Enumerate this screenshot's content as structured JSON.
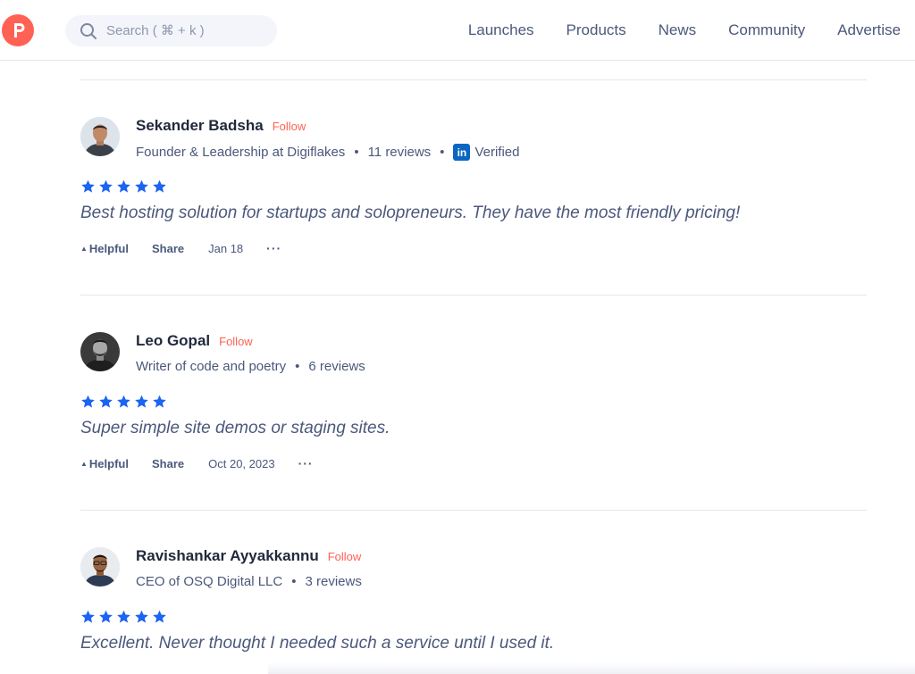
{
  "brand": {
    "logo_letter": "P",
    "accent": "#ff6154"
  },
  "search": {
    "placeholder": "Search ( ⌘ + k )",
    "value": ""
  },
  "nav": {
    "items": [
      {
        "label": "Launches"
      },
      {
        "label": "Products"
      },
      {
        "label": "News"
      },
      {
        "label": "Community"
      },
      {
        "label": "Advertise"
      }
    ]
  },
  "colors": {
    "star": "#1c64f2",
    "linkedin": "#0a66c2",
    "follow": "#ff6154"
  },
  "reviews": [
    {
      "name": "Sekander Badsha",
      "follow_label": "Follow",
      "title": "Founder & Leadership at Digiflakes",
      "reviews_count": "11 reviews",
      "verified_label": "Verified",
      "linkedin_label": "in",
      "rating": 5,
      "text": "Best hosting solution for startups and solopreneurs. They have the most friendly pricing!",
      "helpful_label": "Helpful",
      "share_label": "Share",
      "date": "Jan 18",
      "more_label": "···"
    },
    {
      "name": "Leo Gopal",
      "follow_label": "Follow",
      "title": "Writer of code and poetry",
      "reviews_count": "6 reviews",
      "rating": 5,
      "text": "Super simple site demos or staging sites.",
      "helpful_label": "Helpful",
      "share_label": "Share",
      "date": "Oct 20, 2023",
      "more_label": "···"
    },
    {
      "name": "Ravishankar Ayyakkannu",
      "follow_label": "Follow",
      "title": "CEO of OSQ Digital LLC",
      "reviews_count": "3 reviews",
      "rating": 5,
      "text": "Excellent. Never thought I needed such a service until I used it."
    }
  ]
}
